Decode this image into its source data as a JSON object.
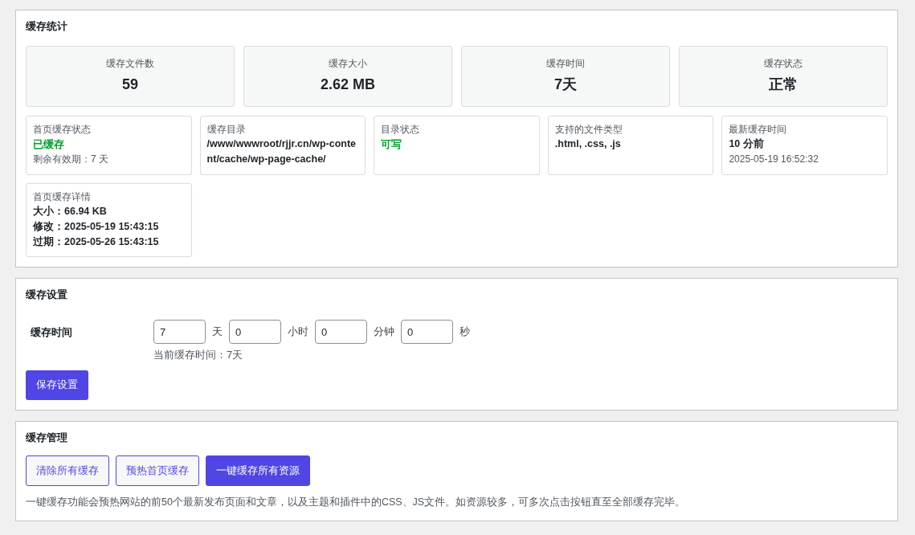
{
  "stats_panel": {
    "title": "缓存统计",
    "stats": [
      {
        "label": "缓存文件数",
        "value": "59"
      },
      {
        "label": "缓存大小",
        "value": "2.62 MB"
      },
      {
        "label": "缓存时间",
        "value": "7天"
      },
      {
        "label": "缓存状态",
        "value": "正常"
      }
    ],
    "info_cards": [
      {
        "label": "首页缓存状态",
        "lines": [
          {
            "kind": "success",
            "text": "已缓存"
          },
          {
            "kind": "note",
            "text": "剩余有效期：7 天"
          }
        ]
      },
      {
        "label": "缓存目录",
        "lines": [
          {
            "kind": "value",
            "text": "/www/wwwroot/rjjr.cn/wp-content/cache/wp-page-cache/"
          }
        ]
      },
      {
        "label": "目录状态",
        "lines": [
          {
            "kind": "success",
            "text": "可写"
          }
        ]
      },
      {
        "label": "支持的文件类型",
        "lines": [
          {
            "kind": "value",
            "text": ".html, .css, .js"
          }
        ]
      },
      {
        "label": "最新缓存时间",
        "lines": [
          {
            "kind": "value",
            "text": "10 分前"
          },
          {
            "kind": "note",
            "text": "2025-05-19 16:52:32"
          }
        ]
      },
      {
        "label": "首页缓存详情",
        "lines": [
          {
            "kind": "value",
            "text": "大小：66.94 KB"
          },
          {
            "kind": "value",
            "text": "修改：2025-05-19 15:43:15"
          },
          {
            "kind": "value",
            "text": "过期：2025-05-26 15:43:15"
          }
        ]
      }
    ]
  },
  "settings_panel": {
    "title": "缓存设置",
    "field_label": "缓存时间",
    "fields": [
      {
        "value": "7",
        "unit": "天"
      },
      {
        "value": "0",
        "unit": "小时"
      },
      {
        "value": "0",
        "unit": "分钟"
      },
      {
        "value": "0",
        "unit": "秒"
      }
    ],
    "current": "当前缓存时间：7天",
    "save_button": "保存设置"
  },
  "manage_panel": {
    "title": "缓存管理",
    "buttons": [
      {
        "kind": "outline",
        "label": "清除所有缓存"
      },
      {
        "kind": "outline",
        "label": "预热首页缓存"
      },
      {
        "kind": "primary",
        "label": "一键缓存所有资源"
      }
    ],
    "note": "一键缓存功能会预热网站的前50个最新发布页面和文章，以及主题和插件中的CSS、JS文件。如资源较多，可多次点击按钮直至全部缓存完毕。"
  }
}
